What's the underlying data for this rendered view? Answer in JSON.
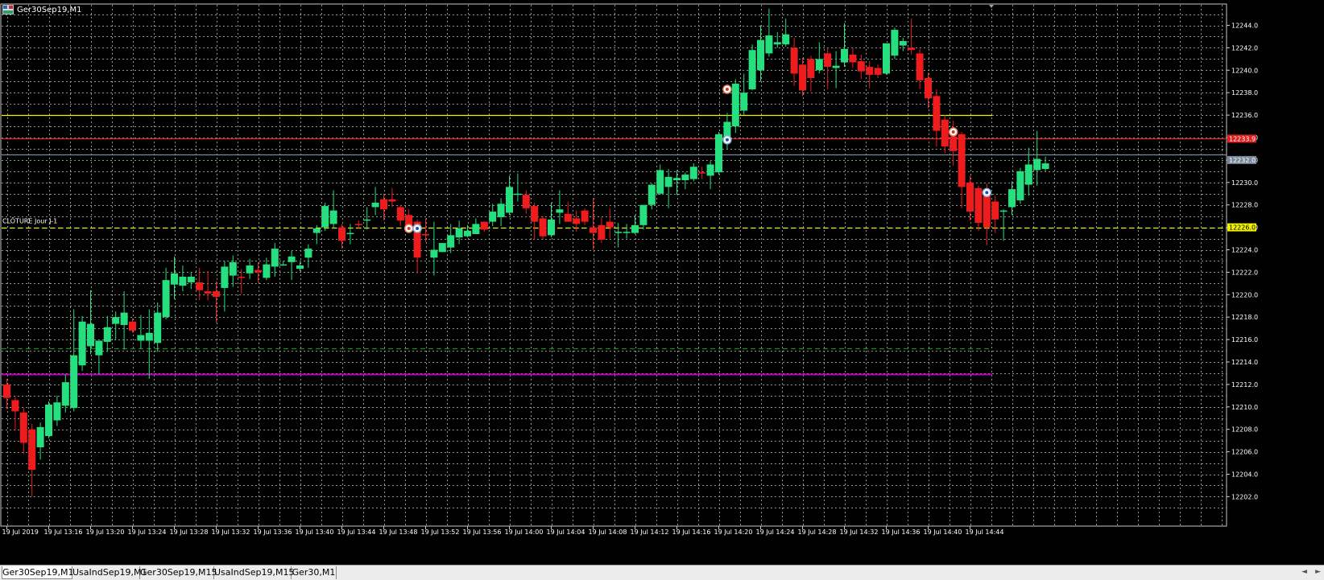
{
  "window": {
    "title": "Ger30Sep19,M1"
  },
  "chart": {
    "background": "#000000",
    "grid_color": "#8a9a8a",
    "bull_color": "#26e07f",
    "bear_color": "#ee1c1c",
    "price_axis_labels": [
      "12244.0",
      "12242.0",
      "12240.0",
      "12238.0",
      "12236.0",
      "12234.0",
      "12232.0",
      "12230.0",
      "12228.0",
      "12226.0",
      "12224.0",
      "12222.0",
      "12220.0",
      "12218.0",
      "12216.0",
      "12214.0",
      "12212.0",
      "12210.0",
      "12208.0",
      "12206.0",
      "12204.0",
      "12202.0"
    ],
    "time_axis_labels": [
      "19 Jul 2019",
      "19 Jul 13:16",
      "19 Jul 13:20",
      "19 Jul 13:24",
      "19 Jul 13:28",
      "19 Jul 13:32",
      "19 Jul 13:36",
      "19 Jul 13:40",
      "19 Jul 13:44",
      "19 Jul 13:48",
      "19 Jul 13:52",
      "19 Jul 13:56",
      "19 Jul 14:00",
      "19 Jul 14:04",
      "19 Jul 14:08",
      "19 Jul 14:12",
      "19 Jul 14:16",
      "19 Jul 14:20",
      "19 Jul 14:24",
      "19 Jul 14:28",
      "19 Jul 14:32",
      "19 Jul 14:36",
      "19 Jul 14:40",
      "19 Jul 14:44"
    ],
    "price_tags": [
      {
        "text": "12233.9",
        "bg": "#e02020",
        "color": "#ffffff",
        "price": 12233.9
      },
      {
        "text": "12232.0",
        "bg": "#7a8a9a",
        "color": "#ffffff",
        "price": 12232.0
      },
      {
        "text": "12226.0",
        "bg": "#f0f000",
        "color": "#000000",
        "price": 12226.0
      }
    ],
    "horizontal_lines": [
      {
        "price": 12236.0,
        "color": "#f0f000",
        "style": "solid"
      },
      {
        "price": 12233.9,
        "color": "#e02020",
        "style": "solid"
      },
      {
        "price": 12232.5,
        "color": "#7a8a9a",
        "style": "solid"
      },
      {
        "price": 12226.0,
        "color": "#f0f000",
        "style": "dashed"
      },
      {
        "price": 12215.2,
        "color": "#1e8a1e",
        "style": "dashed"
      },
      {
        "price": 12212.9,
        "color": "#c000c0",
        "style": "solid"
      }
    ],
    "closing_label": "CLÔTURE Jour J-1",
    "candles": [
      {
        "o": 12212.0,
        "h": 12212.5,
        "l": 12209.8,
        "c": 12210.8
      },
      {
        "o": 12210.6,
        "h": 12210.9,
        "l": 12207.9,
        "c": 12209.6
      },
      {
        "o": 12209.5,
        "h": 12209.9,
        "l": 12205.8,
        "c": 12206.8
      },
      {
        "o": 12208.0,
        "h": 12208.5,
        "l": 12202.0,
        "c": 12204.4
      },
      {
        "o": 12206.4,
        "h": 12208.6,
        "l": 12205.3,
        "c": 12208.2
      },
      {
        "o": 12207.4,
        "h": 12210.5,
        "l": 12207.2,
        "c": 12210.2
      },
      {
        "o": 12208.8,
        "h": 12211.0,
        "l": 12208.3,
        "c": 12210.4
      },
      {
        "o": 12210.1,
        "h": 12212.9,
        "l": 12209.5,
        "c": 12212.2
      },
      {
        "o": 12209.9,
        "h": 12218.7,
        "l": 12209.6,
        "c": 12214.6
      },
      {
        "o": 12213.7,
        "h": 12218.1,
        "l": 12213.2,
        "c": 12217.6
      },
      {
        "o": 12215.4,
        "h": 12220.4,
        "l": 12214.7,
        "c": 12217.4
      },
      {
        "o": 12214.6,
        "h": 12215.9,
        "l": 12212.9,
        "c": 12215.9
      },
      {
        "o": 12215.8,
        "h": 12218.1,
        "l": 12214.9,
        "c": 12217.1
      },
      {
        "o": 12217.4,
        "h": 12218.5,
        "l": 12216.0,
        "c": 12218.0
      },
      {
        "o": 12217.3,
        "h": 12220.3,
        "l": 12215.1,
        "c": 12218.4
      },
      {
        "o": 12217.6,
        "h": 12217.9,
        "l": 12216.6,
        "c": 12216.8
      },
      {
        "o": 12215.9,
        "h": 12218.2,
        "l": 12215.2,
        "c": 12216.4
      },
      {
        "o": 12215.9,
        "h": 12218.7,
        "l": 12212.5,
        "c": 12216.6
      },
      {
        "o": 12215.7,
        "h": 12219.3,
        "l": 12214.9,
        "c": 12218.4
      },
      {
        "o": 12218.0,
        "h": 12222.4,
        "l": 12217.8,
        "c": 12221.3
      },
      {
        "o": 12220.9,
        "h": 12223.4,
        "l": 12219.6,
        "c": 12221.9
      },
      {
        "o": 12220.8,
        "h": 12222.6,
        "l": 12220.3,
        "c": 12221.6
      },
      {
        "o": 12221.1,
        "h": 12222.0,
        "l": 12220.5,
        "c": 12221.6
      },
      {
        "o": 12221.1,
        "h": 12222.4,
        "l": 12219.5,
        "c": 12220.4
      },
      {
        "o": 12220.3,
        "h": 12222.1,
        "l": 12219.5,
        "c": 12220.1
      },
      {
        "o": 12220.3,
        "h": 12221.2,
        "l": 12217.5,
        "c": 12219.8
      },
      {
        "o": 12220.6,
        "h": 12223.0,
        "l": 12218.5,
        "c": 12222.5
      },
      {
        "o": 12221.7,
        "h": 12223.5,
        "l": 12220.7,
        "c": 12222.9
      },
      {
        "o": 12221.6,
        "h": 12222.3,
        "l": 12220.1,
        "c": 12221.5
      },
      {
        "o": 12221.9,
        "h": 12223.2,
        "l": 12221.4,
        "c": 12222.6
      },
      {
        "o": 12222.2,
        "h": 12222.9,
        "l": 12221.1,
        "c": 12222.0
      },
      {
        "o": 12221.5,
        "h": 12223.3,
        "l": 12221.3,
        "c": 12222.7
      },
      {
        "o": 12222.5,
        "h": 12224.6,
        "l": 12221.6,
        "c": 12224.1
      },
      {
        "o": 12222.6,
        "h": 12223.0,
        "l": 12222.6,
        "c": 12222.7
      },
      {
        "o": 12222.9,
        "h": 12223.9,
        "l": 12221.3,
        "c": 12223.4
      },
      {
        "o": 12222.3,
        "h": 12222.9,
        "l": 12222.1,
        "c": 12222.6
      },
      {
        "o": 12223.3,
        "h": 12224.5,
        "l": 12222.4,
        "c": 12224.1
      },
      {
        "o": 12225.5,
        "h": 12226.2,
        "l": 12224.5,
        "c": 12225.9
      },
      {
        "o": 12226.0,
        "h": 12228.2,
        "l": 12225.7,
        "c": 12227.9
      },
      {
        "o": 12226.3,
        "h": 12229.3,
        "l": 12225.9,
        "c": 12227.5
      },
      {
        "o": 12226.0,
        "h": 12226.3,
        "l": 12224.1,
        "c": 12224.8
      },
      {
        "o": 12225.4,
        "h": 12226.3,
        "l": 12224.5,
        "c": 12225.5
      },
      {
        "o": 12226.3,
        "h": 12226.6,
        "l": 12225.9,
        "c": 12226.2
      },
      {
        "o": 12226.6,
        "h": 12227.8,
        "l": 12225.8,
        "c": 12226.7
      },
      {
        "o": 12227.8,
        "h": 12229.6,
        "l": 12227.1,
        "c": 12228.2
      },
      {
        "o": 12228.5,
        "h": 12229.0,
        "l": 12226.6,
        "c": 12227.6
      },
      {
        "o": 12228.5,
        "h": 12229.5,
        "l": 12227.8,
        "c": 12228.3
      },
      {
        "o": 12227.8,
        "h": 12228.0,
        "l": 12226.1,
        "c": 12226.6
      },
      {
        "o": 12227.1,
        "h": 12227.6,
        "l": 12225.6,
        "c": 12226.1
      },
      {
        "o": 12226.5,
        "h": 12226.7,
        "l": 12221.9,
        "c": 12223.3
      },
      {
        "o": 12225.4,
        "h": 12226.8,
        "l": 12224.7,
        "c": 12225.3
      },
      {
        "o": 12223.3,
        "h": 12226.5,
        "l": 12221.7,
        "c": 12224.0
      },
      {
        "o": 12223.8,
        "h": 12224.6,
        "l": 12223.8,
        "c": 12224.6
      },
      {
        "o": 12224.2,
        "h": 12226.3,
        "l": 12223.7,
        "c": 12225.3
      },
      {
        "o": 12225.1,
        "h": 12226.6,
        "l": 12224.5,
        "c": 12225.9
      },
      {
        "o": 12225.2,
        "h": 12226.2,
        "l": 12225.1,
        "c": 12225.7
      },
      {
        "o": 12225.4,
        "h": 12226.8,
        "l": 12225.4,
        "c": 12226.3
      },
      {
        "o": 12226.5,
        "h": 12226.5,
        "l": 12225.6,
        "c": 12225.8
      },
      {
        "o": 12226.5,
        "h": 12228.1,
        "l": 12226.1,
        "c": 12227.4
      },
      {
        "o": 12226.9,
        "h": 12228.6,
        "l": 12226.1,
        "c": 12228.1
      },
      {
        "o": 12227.3,
        "h": 12230.6,
        "l": 12227.1,
        "c": 12229.6
      },
      {
        "o": 12228.9,
        "h": 12230.8,
        "l": 12228.3,
        "c": 12229.0
      },
      {
        "o": 12228.9,
        "h": 12229.3,
        "l": 12227.2,
        "c": 12227.7
      },
      {
        "o": 12227.9,
        "h": 12228.2,
        "l": 12224.9,
        "c": 12226.5
      },
      {
        "o": 12226.8,
        "h": 12227.0,
        "l": 12224.9,
        "c": 12225.2
      },
      {
        "o": 12225.3,
        "h": 12228.2,
        "l": 12225.1,
        "c": 12226.7
      },
      {
        "o": 12227.3,
        "h": 12229.3,
        "l": 12226.3,
        "c": 12227.6
      },
      {
        "o": 12227.2,
        "h": 12228.3,
        "l": 12226.5,
        "c": 12226.5
      },
      {
        "o": 12226.8,
        "h": 12227.5,
        "l": 12225.6,
        "c": 12226.3
      },
      {
        "o": 12227.5,
        "h": 12227.7,
        "l": 12226.2,
        "c": 12226.5
      },
      {
        "o": 12226.0,
        "h": 12228.6,
        "l": 12224.0,
        "c": 12225.5
      },
      {
        "o": 12226.2,
        "h": 12226.9,
        "l": 12224.6,
        "c": 12224.9
      },
      {
        "o": 12226.5,
        "h": 12227.7,
        "l": 12225.0,
        "c": 12226.0
      },
      {
        "o": 12225.6,
        "h": 12226.4,
        "l": 12224.2,
        "c": 12225.6
      },
      {
        "o": 12225.6,
        "h": 12226.3,
        "l": 12225.0,
        "c": 12225.6
      },
      {
        "o": 12225.5,
        "h": 12227.1,
        "l": 12225.4,
        "c": 12226.2
      },
      {
        "o": 12226.2,
        "h": 12227.8,
        "l": 12225.8,
        "c": 12228.0
      },
      {
        "o": 12228.0,
        "h": 12229.9,
        "l": 12227.6,
        "c": 12229.8
      },
      {
        "o": 12229.0,
        "h": 12231.6,
        "l": 12228.9,
        "c": 12231.1
      },
      {
        "o": 12229.6,
        "h": 12231.2,
        "l": 12227.7,
        "c": 12230.5
      },
      {
        "o": 12230.2,
        "h": 12231.1,
        "l": 12228.9,
        "c": 12230.4
      },
      {
        "o": 12230.2,
        "h": 12230.9,
        "l": 12229.4,
        "c": 12230.7
      },
      {
        "o": 12230.3,
        "h": 12231.7,
        "l": 12230.1,
        "c": 12231.4
      },
      {
        "o": 12230.9,
        "h": 12231.4,
        "l": 12230.3,
        "c": 12230.8
      },
      {
        "o": 12230.6,
        "h": 12231.9,
        "l": 12229.4,
        "c": 12231.6
      },
      {
        "o": 12230.9,
        "h": 12234.5,
        "l": 12230.7,
        "c": 12234.3
      },
      {
        "o": 12233.5,
        "h": 12236.2,
        "l": 12233.0,
        "c": 12235.4
      },
      {
        "o": 12235.0,
        "h": 12239.2,
        "l": 12234.4,
        "c": 12238.8
      },
      {
        "o": 12236.4,
        "h": 12239.7,
        "l": 12236.0,
        "c": 12238.0
      },
      {
        "o": 12238.3,
        "h": 12242.3,
        "l": 12238.2,
        "c": 12241.8
      },
      {
        "o": 12240.0,
        "h": 12244.0,
        "l": 12239.0,
        "c": 12242.7
      },
      {
        "o": 12241.5,
        "h": 12245.5,
        "l": 12241.2,
        "c": 12243.1
      },
      {
        "o": 12242.3,
        "h": 12243.4,
        "l": 12242.0,
        "c": 12242.5
      },
      {
        "o": 12242.3,
        "h": 12244.6,
        "l": 12242.1,
        "c": 12243.2
      },
      {
        "o": 12242.0,
        "h": 12242.9,
        "l": 12238.6,
        "c": 12239.7
      },
      {
        "o": 12240.5,
        "h": 12241.1,
        "l": 12237.7,
        "c": 12238.2
      },
      {
        "o": 12241.0,
        "h": 12241.3,
        "l": 12238.1,
        "c": 12239.3
      },
      {
        "o": 12240.0,
        "h": 12242.5,
        "l": 12239.7,
        "c": 12241.0
      },
      {
        "o": 12241.5,
        "h": 12242.0,
        "l": 12238.3,
        "c": 12240.3
      },
      {
        "o": 12240.2,
        "h": 12241.7,
        "l": 12238.4,
        "c": 12240.4
      },
      {
        "o": 12240.7,
        "h": 12244.2,
        "l": 12240.3,
        "c": 12241.9
      },
      {
        "o": 12241.4,
        "h": 12242.0,
        "l": 12240.2,
        "c": 12240.7
      },
      {
        "o": 12240.8,
        "h": 12241.4,
        "l": 12239.2,
        "c": 12239.9
      },
      {
        "o": 12240.3,
        "h": 12240.8,
        "l": 12238.4,
        "c": 12239.6
      },
      {
        "o": 12240.2,
        "h": 12240.5,
        "l": 12239.3,
        "c": 12239.6
      },
      {
        "o": 12239.7,
        "h": 12242.2,
        "l": 12239.6,
        "c": 12242.4
      },
      {
        "o": 12241.3,
        "h": 12243.8,
        "l": 12241.0,
        "c": 12243.6
      },
      {
        "o": 12242.2,
        "h": 12242.9,
        "l": 12241.7,
        "c": 12242.6
      },
      {
        "o": 12242.0,
        "h": 12244.6,
        "l": 12241.4,
        "c": 12241.8
      },
      {
        "o": 12241.5,
        "h": 12241.9,
        "l": 12238.3,
        "c": 12239.1
      },
      {
        "o": 12239.3,
        "h": 12239.8,
        "l": 12236.6,
        "c": 12237.5
      },
      {
        "o": 12237.7,
        "h": 12238.3,
        "l": 12233.2,
        "c": 12234.6
      },
      {
        "o": 12235.6,
        "h": 12236.0,
        "l": 12232.6,
        "c": 12233.2
      },
      {
        "o": 12234.1,
        "h": 12235.5,
        "l": 12231.5,
        "c": 12232.8
      },
      {
        "o": 12234.3,
        "h": 12234.5,
        "l": 12227.7,
        "c": 12229.6
      },
      {
        "o": 12230.0,
        "h": 12230.6,
        "l": 12226.6,
        "c": 12227.4
      },
      {
        "o": 12229.5,
        "h": 12229.7,
        "l": 12225.7,
        "c": 12226.4
      },
      {
        "o": 12229.1,
        "h": 12229.9,
        "l": 12224.4,
        "c": 12226.0
      },
      {
        "o": 12228.3,
        "h": 12228.8,
        "l": 12225.5,
        "c": 12226.7
      },
      {
        "o": 12227.4,
        "h": 12227.6,
        "l": 12224.8,
        "c": 12227.5
      },
      {
        "o": 12227.8,
        "h": 12230.1,
        "l": 12227.1,
        "c": 12229.4
      },
      {
        "o": 12228.4,
        "h": 12231.3,
        "l": 12228.1,
        "c": 12231.0
      },
      {
        "o": 12229.8,
        "h": 12233.1,
        "l": 12228.8,
        "c": 12231.6
      },
      {
        "o": 12231.1,
        "h": 12234.6,
        "l": 12229.7,
        "c": 12232.1
      },
      {
        "o": 12231.2,
        "h": 12232.3,
        "l": 12231.0,
        "c": 12231.7
      }
    ],
    "markers": [
      {
        "index": 48,
        "price": 12225.9,
        "type": "sell"
      },
      {
        "index": 49,
        "price": 12225.9,
        "type": "buy"
      },
      {
        "index": 86,
        "price": 12238.3,
        "type": "sell"
      },
      {
        "index": 86,
        "price": 12233.8,
        "type": "buy"
      },
      {
        "index": 113,
        "price": 12234.5,
        "type": "sell"
      },
      {
        "index": 117,
        "price": 12229.1,
        "type": "buy"
      }
    ]
  },
  "tabs": [
    {
      "label": "Ger30Sep19,M1",
      "active": true
    },
    {
      "label": "UsaIndSep19,M1",
      "active": false
    },
    {
      "label": "Ger30Sep19,M15",
      "active": false
    },
    {
      "label": "UsaIndSep19,M15",
      "active": false
    },
    {
      "label": "Ger30,M1",
      "active": false
    }
  ]
}
